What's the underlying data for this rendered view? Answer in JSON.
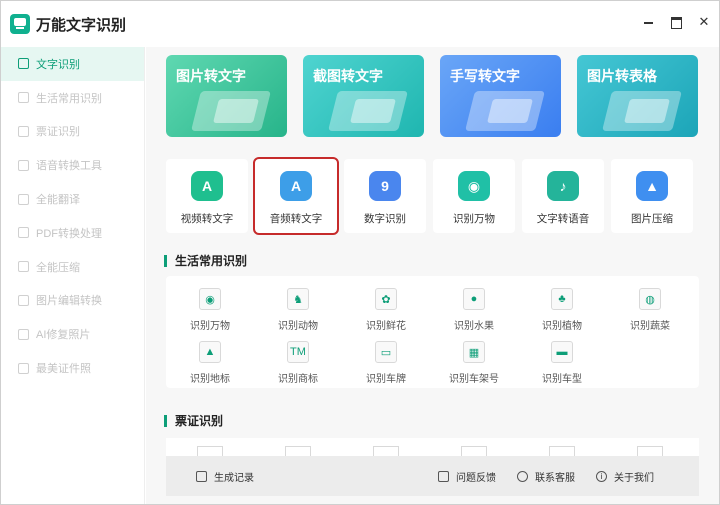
{
  "app": {
    "title": "万能文字识别"
  },
  "sidebar": {
    "items": [
      {
        "label": "文字识别",
        "active": true
      },
      {
        "label": "生活常用识别"
      },
      {
        "label": "票证识别"
      },
      {
        "label": "语音转换工具"
      },
      {
        "label": "全能翻译"
      },
      {
        "label": "PDF转换处理"
      },
      {
        "label": "全能压缩"
      },
      {
        "label": "图片编辑转换"
      },
      {
        "label": "AI修复照片"
      },
      {
        "label": "最美证件照"
      }
    ]
  },
  "banners": [
    {
      "label": "图片转文字",
      "color": "#27b48a"
    },
    {
      "label": "截图转文字",
      "color": "#1fb6b0"
    },
    {
      "label": "手写转文字",
      "color": "#3a7ef0"
    },
    {
      "label": "图片转表格",
      "color": "#1ca5b8"
    }
  ],
  "tools": [
    {
      "label": "视频转文字",
      "icon": "video-a-icon",
      "glyph": "A",
      "color": "#1fbf8f"
    },
    {
      "label": "音频转文字",
      "icon": "audio-a-icon",
      "glyph": "A",
      "color": "#3d9ee8",
      "selected": true
    },
    {
      "label": "数字识别",
      "icon": "number-9-icon",
      "glyph": "9",
      "color": "#4a86ee"
    },
    {
      "label": "识别万物",
      "icon": "eye-icon",
      "glyph": "◉",
      "color": "#20c0a6"
    },
    {
      "label": "文字转语音",
      "icon": "music-note-icon",
      "glyph": "♪",
      "color": "#24b49a"
    },
    {
      "label": "图片压缩",
      "icon": "image-compress-icon",
      "glyph": "▲",
      "color": "#3f8ff0"
    }
  ],
  "life": {
    "title": "生活常用识别",
    "items": [
      {
        "label": "识别万物",
        "icon": "eye-icon",
        "glyph": "◉"
      },
      {
        "label": "识别动物",
        "icon": "animal-icon",
        "glyph": "♞"
      },
      {
        "label": "识别鲜花",
        "icon": "flower-icon",
        "glyph": "✿"
      },
      {
        "label": "识别水果",
        "icon": "apple-icon",
        "glyph": "●"
      },
      {
        "label": "识别植物",
        "icon": "plant-icon",
        "glyph": "♣"
      },
      {
        "label": "识别蔬菜",
        "icon": "vegetable-icon",
        "glyph": "◍"
      },
      {
        "label": "识别地标",
        "icon": "landmark-icon",
        "glyph": "▲"
      },
      {
        "label": "识别商标",
        "icon": "trademark-icon",
        "glyph": "TM"
      },
      {
        "label": "识别车牌",
        "icon": "car-icon",
        "glyph": "▭"
      },
      {
        "label": "识别车架号",
        "icon": "vin-icon",
        "glyph": "▦"
      },
      {
        "label": "识别车型",
        "icon": "truck-icon",
        "glyph": "▬"
      }
    ]
  },
  "cert": {
    "title": "票证识别"
  },
  "footer": {
    "history": "生成记录",
    "feedback": "问题反馈",
    "support": "联系客服",
    "about": "关于我们"
  }
}
